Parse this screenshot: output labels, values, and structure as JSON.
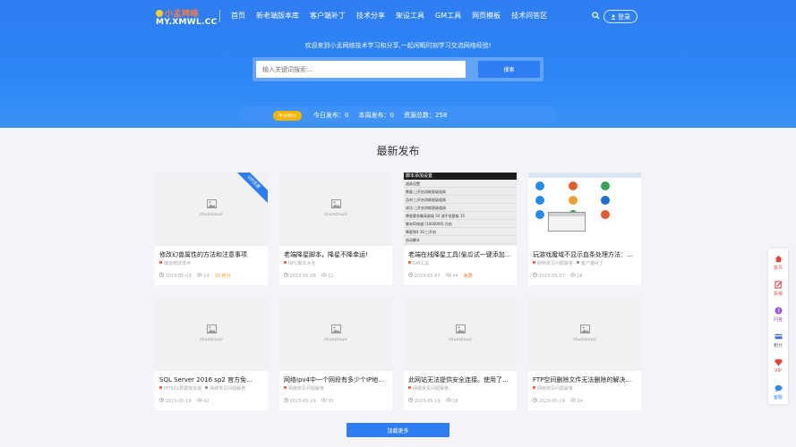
{
  "header": {
    "logo_cn": "小孟网络",
    "logo_en": "MY.XMWL.CC",
    "nav": [
      "首页",
      "新老端版本库",
      "客户端补丁",
      "技术分享",
      "架设工具",
      "GM工具",
      "网页模板",
      "技术问答区"
    ],
    "login_label": "登录"
  },
  "hero": {
    "welcome": "欢迎来到小孟网络技术学习和分享,一起闲暇时刻学习交流网络经验!",
    "search_placeholder": "输入关键词搜索...",
    "search_button": "搜索",
    "badge": "平台统计",
    "stats": [
      "今日发布：0",
      "本周发布：0",
      "资源总数：258"
    ]
  },
  "section_title": "最新发布",
  "cards": [
    {
      "title": "修改幻兽属性的方法和注意事项",
      "cat": "魔兽修改技术",
      "cat2": "",
      "date": "2023-05-09",
      "views": "14",
      "tag": "10 积分",
      "vip": "VIP资源"
    },
    {
      "title": "老端降星脚本，降星不降幸运!",
      "cat": "NPC脚本大全",
      "cat2": "",
      "date": "2023-05-08",
      "views": "11",
      "tag": ""
    },
    {
      "title": "老端在线降星工具(偷瓜试一键添加...",
      "cat": "GM工具",
      "cat2": "",
      "date": "2023-05-07",
      "views": "44",
      "tag": "免费"
    },
    {
      "title": "玩游戏魔域不显示血条处理方法：...",
      "cat": "网络常见问题解答",
      "cat2": "客户端补丁",
      "date": "2023-05-07",
      "views": "16",
      "tag": ""
    },
    {
      "title": "SQL Server 2016 sp2 官方免...",
      "cat": "MYSQL数据库安装",
      "cat2": "网络常见问题解答",
      "date": "2023-05-19",
      "views": "42",
      "tag": ""
    },
    {
      "title": "网络ipv4中一个网段有多少个IP地...",
      "cat": "网络常见问题解答",
      "cat2": "",
      "date": "2023-05-19",
      "views": "35",
      "tag": ""
    },
    {
      "title": "此网站无法提供安全连接。使用了...",
      "cat": "网络常见问题解答",
      "cat2": "",
      "date": "2023-05-19",
      "views": "18",
      "tag": ""
    },
    {
      "title": "FTP空间删除文件无法删除的解决...",
      "cat": "网络常见问题解答",
      "cat2": "",
      "date": "2023-05-19",
      "views": "24",
      "tag": ""
    }
  ],
  "thumb_text": "thumbnail",
  "thumb3": {
    "header": "脚本添加设置",
    "rows": [
      "道具设置",
      "数量 □开启消耗星级道具",
      "品材 □开启消耗星级道具",
      "成功 □开启消耗星级道具",
      "降星要求最高星级 50 减不低星级 35",
      "脚本ID前缀 [1000000] 开启",
      "降星到4 30 □开启",
      "启动脚本"
    ]
  },
  "load_more": "加载更多",
  "sidebar": [
    {
      "label": "首页",
      "color": "#e0453a"
    },
    {
      "label": "投稿",
      "color": "#e0453a"
    },
    {
      "label": "问答",
      "color": "#9b59d0"
    },
    {
      "label": "积分",
      "color": "#3d6fe0"
    },
    {
      "label": "VIP",
      "color": "#e0453a"
    },
    {
      "label": "客服",
      "color": "#2f86f4"
    }
  ],
  "colors": {
    "primary": "#2f7df2",
    "badge": "#f7b500",
    "ribbon": "#2f7df2"
  }
}
